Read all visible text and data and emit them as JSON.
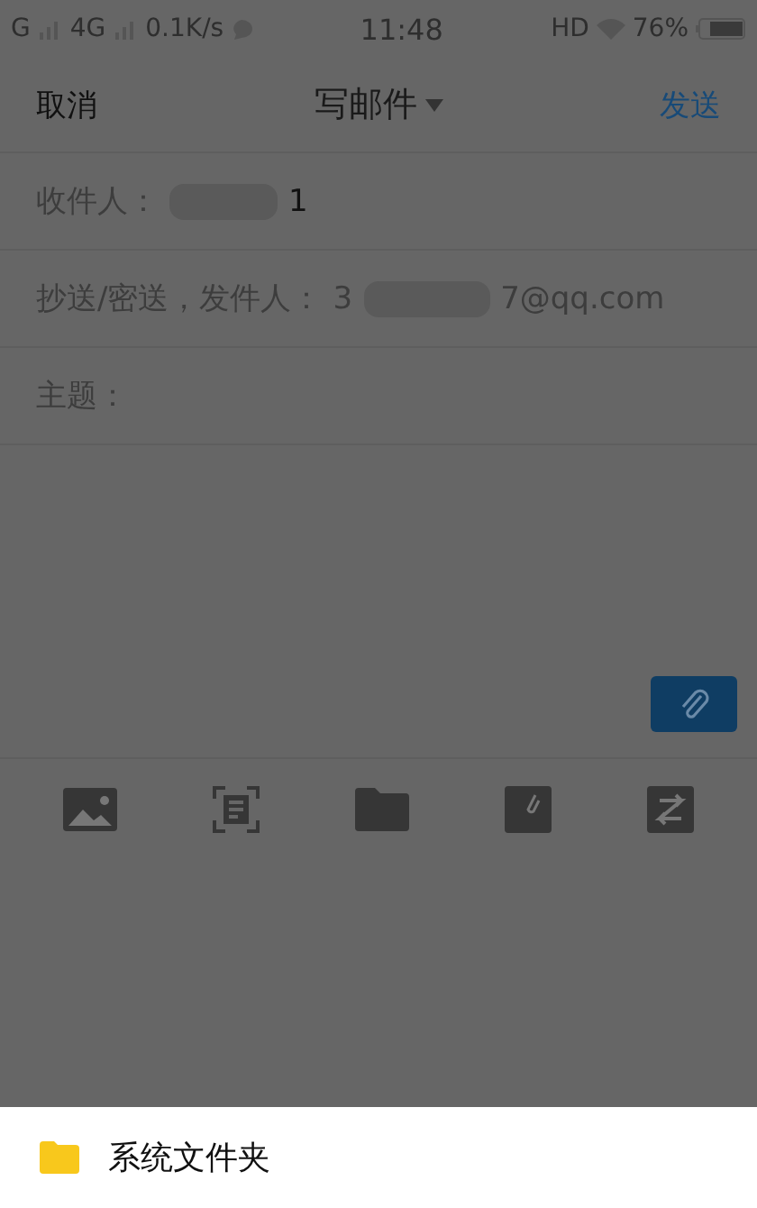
{
  "status_bar": {
    "carrier_1": "G",
    "carrier_2": "4G",
    "speed": "0.1K/s",
    "time": "11:48",
    "hd": "HD",
    "battery": "76%"
  },
  "header": {
    "cancel": "取消",
    "title": "写邮件",
    "send": "发送"
  },
  "fields": [
    {
      "label": "收件人：",
      "value_end": "1",
      "redacted": true
    },
    {
      "label": "抄送/密送，发件人：",
      "value_start": "3",
      "value_end": "7@qq.com",
      "redacted": true
    },
    {
      "label": "主题：",
      "redacted": false
    }
  ],
  "toolbar": [
    {
      "kind": "image"
    },
    {
      "kind": "scan"
    },
    {
      "kind": "folder"
    },
    {
      "kind": "note"
    },
    {
      "kind": "swap"
    }
  ],
  "sheet": {
    "items": [
      {
        "label": "系统文件夹"
      }
    ]
  }
}
